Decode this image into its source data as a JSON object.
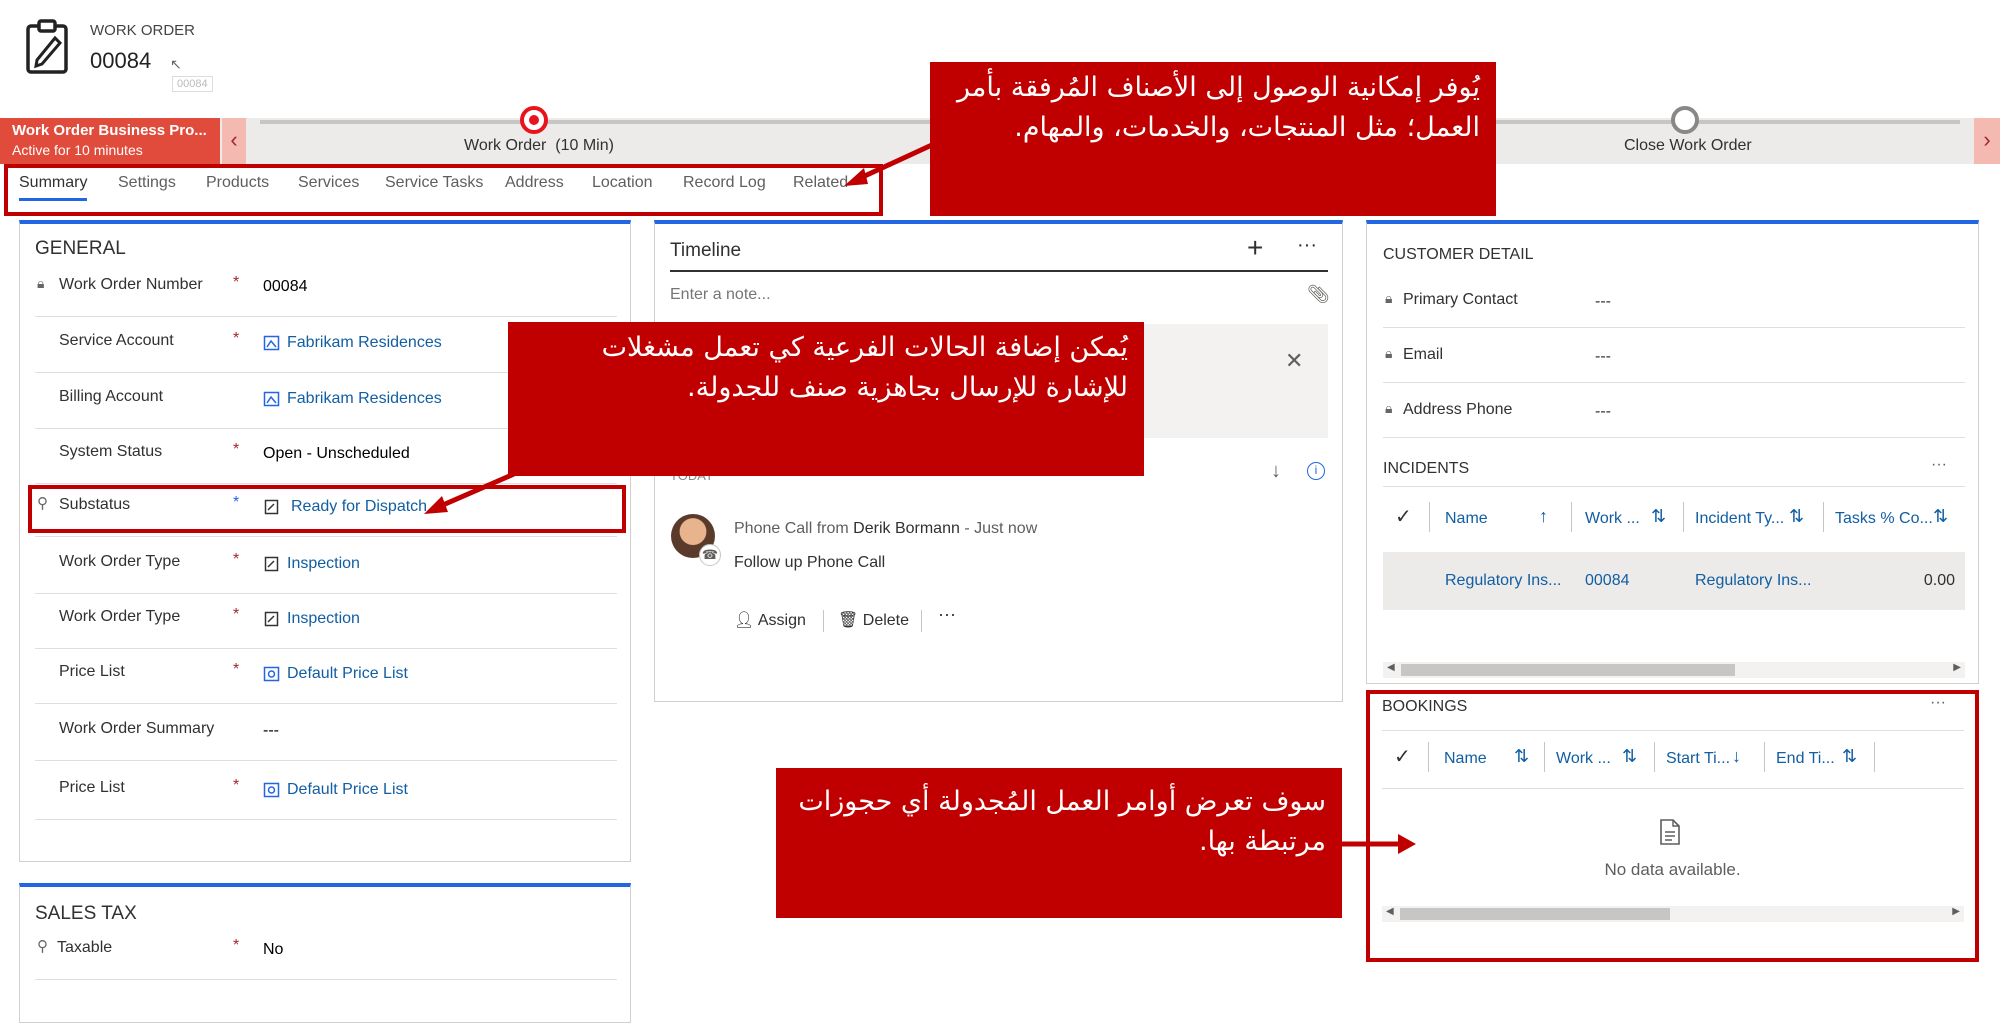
{
  "header": {
    "entity": "WORK ORDER",
    "number": "00084",
    "tooltip": "00084"
  },
  "bpf": {
    "process_name": "Work Order Business Pro...",
    "active_for": "Active for 10 minutes",
    "stage1_name": "Work Order",
    "stage1_duration": "(10 Min)",
    "stage2_name": "Close Work Order"
  },
  "tabs": [
    "Summary",
    "Settings",
    "Products",
    "Services",
    "Service Tasks",
    "Address",
    "Location",
    "Record Log",
    "Related"
  ],
  "general": {
    "title": "GENERAL",
    "fields": [
      {
        "label": "Work Order Number",
        "value": "00084"
      },
      {
        "label": "Service Account",
        "value": "Fabrikam Residences"
      },
      {
        "label": "Billing Account",
        "value": "Fabrikam Residences"
      },
      {
        "label": "System Status",
        "value": "Open - Unscheduled"
      },
      {
        "label": "Substatus",
        "value": "Ready for Dispatch"
      },
      {
        "label": "Work Order Type",
        "value": "Inspection"
      },
      {
        "label": "Work Order Type",
        "value": "Inspection"
      },
      {
        "label": "Price List",
        "value": "Default Price List"
      },
      {
        "label": "Work Order Summary",
        "value": "---"
      },
      {
        "label": "Price List",
        "value": "Default Price List"
      }
    ]
  },
  "sales_tax": {
    "title": "SALES TAX",
    "label": "Taxable",
    "value": "No"
  },
  "timeline": {
    "title": "Timeline",
    "placeholder": "Enter a note...",
    "section": "TODAY",
    "activity_type": "Phone Call from",
    "activity_person": "Derik Bormann",
    "activity_dash": "-",
    "activity_time": "Just now",
    "activity_subject": "Follow up Phone Call",
    "assign": "Assign",
    "delete": "Delete",
    "more": "···"
  },
  "customer": {
    "title": "CUSTOMER DETAIL",
    "fields": [
      {
        "label": "Primary Contact",
        "value": "---"
      },
      {
        "label": "Email",
        "value": "---"
      },
      {
        "label": "Address Phone",
        "value": "---"
      }
    ]
  },
  "incidents": {
    "title": "INCIDENTS",
    "columns": [
      "Name",
      "Work ...",
      "Incident Ty...",
      "Tasks % Co..."
    ],
    "row": [
      "Regulatory Ins...",
      "00084",
      "Regulatory Ins...",
      "0.00"
    ]
  },
  "bookings": {
    "title": "BOOKINGS",
    "columns": [
      "Name",
      "Work ...",
      "Start Ti...",
      "End Ti..."
    ],
    "empty": "No data available."
  },
  "callouts": {
    "tabs": "يُوفر إمكانية الوصول إلى الأصناف المُرفقة بأمر العمل؛ مثل المنتجات، والخدمات، والمهام.",
    "substatus": "يُمكن إضافة الحالات الفرعية كي تعمل مشغلات للإشارة للإرسال بجاهزية صنف للجدولة.",
    "bookings": "سوف تعرض أوامر العمل المُجدولة أي حجوزات مرتبطة بها."
  },
  "colors": {
    "accent": "#2266e3",
    "callout": "#c00000",
    "link": "#115ea3",
    "bpf_active": "#e04b3c"
  }
}
